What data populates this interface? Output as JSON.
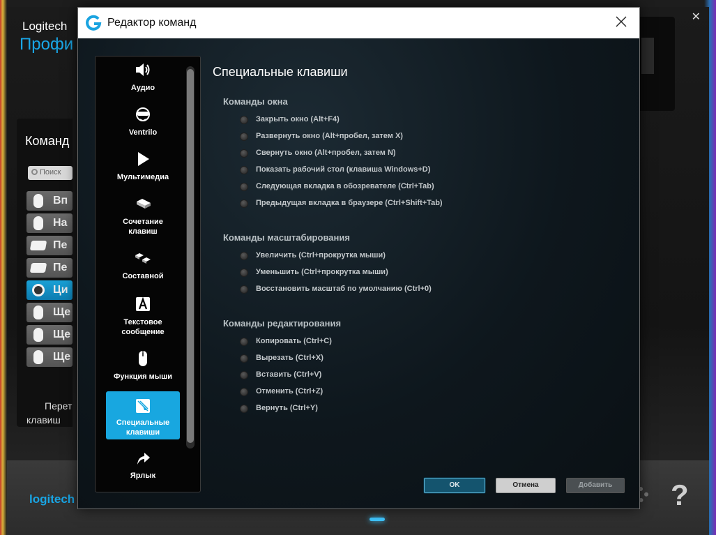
{
  "background": {
    "brand": "Logitech",
    "profile_label": "Профи",
    "commands_title": "Команд",
    "search_placeholder": "Поиск",
    "command_items": [
      {
        "label": "Вп",
        "icon": "mouse-icon"
      },
      {
        "label": "На",
        "icon": "mouse-icon"
      },
      {
        "label": "Пе",
        "icon": "keyboard-key-icon"
      },
      {
        "label": "Пе",
        "icon": "keyboard-key-icon"
      },
      {
        "label": "Ци",
        "icon": "gear-f-icon"
      },
      {
        "label": "Ще",
        "icon": "mouse-icon"
      },
      {
        "label": "Ще",
        "icon": "mouse-icon"
      },
      {
        "label": "Ще",
        "icon": "mouse-icon"
      }
    ],
    "reassign_line1": "Перет",
    "reassign_line2": "клавиш",
    "logo_text": "logitech",
    "help_glyph": "?",
    "close_glyph": "✕"
  },
  "dialog": {
    "title": "Редактор команд",
    "sidebar": [
      {
        "label": "Аудио",
        "icon": "speaker-icon"
      },
      {
        "label": "Ventrilo",
        "icon": "headset-icon"
      },
      {
        "label": "Мультимедиа",
        "icon": "play-icon"
      },
      {
        "label": "Сочетание клавиш",
        "icon": "keys-combo-icon"
      },
      {
        "label": "Составной",
        "icon": "multi-key-icon"
      },
      {
        "label": "Текстовое сообщение",
        "icon": "text-a-icon"
      },
      {
        "label": "Функция мыши",
        "icon": "mouse-function-icon"
      },
      {
        "label": "Специальные клавиши",
        "icon": "special-key-icon",
        "active": true
      },
      {
        "label": "Ярлык",
        "icon": "shortcut-arrow-icon"
      }
    ],
    "content_title": "Специальные клавиши",
    "groups": [
      {
        "title": "Команды окна",
        "options": [
          "Закрыть окно (Alt+F4)",
          "Развернуть окно (Alt+пробел, затем X)",
          "Свернуть окно (Alt+пробел, затем N)",
          "Показать рабочий стол (клавиша Windows+D)",
          "Следующая вкладка в обозревателе (Ctrl+Tab)",
          "Предыдущая вкладка в браузере (Ctrl+Shift+Tab)"
        ]
      },
      {
        "title": "Команды масштабирования",
        "options": [
          "Увеличить (Ctrl+прокрутка мыши)",
          "Уменьшить (Ctrl+прокрутка мыши)",
          "Восстановить масштаб по умолчанию (Ctrl+0)"
        ]
      },
      {
        "title": "Команды редактирования",
        "options": [
          "Копировать (Ctrl+C)",
          "Вырезать (Ctrl+X)",
          "Вставить (Ctrl+V)",
          "Отменить (Ctrl+Z)",
          "Вернуть (Ctrl+Y)"
        ]
      }
    ],
    "buttons": {
      "ok": "OK",
      "cancel": "Отмена",
      "add": "Добавить"
    }
  },
  "colors": {
    "accent": "#18a7e0",
    "brand_blue": "#19a6e6"
  }
}
